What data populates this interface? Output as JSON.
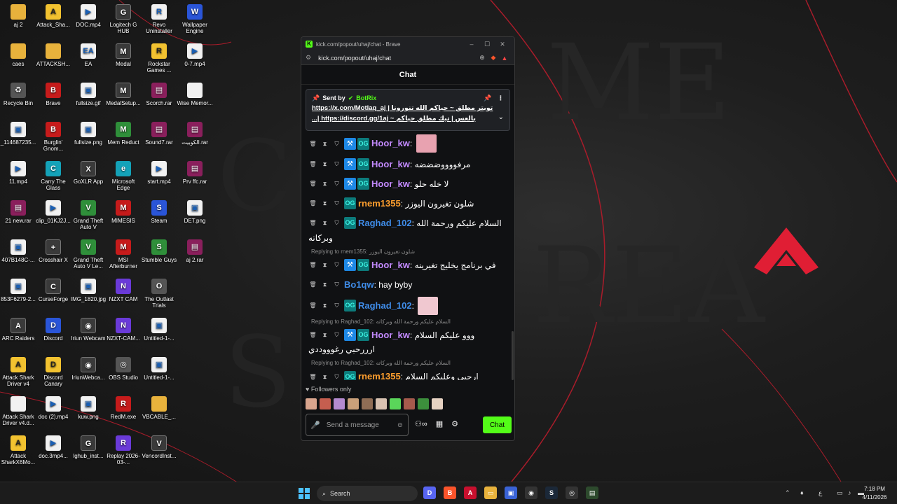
{
  "desktop": {
    "icons": [
      {
        "label": "aj 2",
        "glyph": "",
        "kind": "folder",
        "col": 0,
        "row": 0
      },
      {
        "label": "Attack_Sha...",
        "glyph": "A",
        "kind": "yellow",
        "col": 1,
        "row": 0
      },
      {
        "label": "DOC.mp4",
        "glyph": "▶",
        "kind": "file",
        "col": 2,
        "row": 0
      },
      {
        "label": "Logitech G HUB",
        "glyph": "G",
        "kind": "app",
        "col": 3,
        "row": 0
      },
      {
        "label": "Revo Uninstaller",
        "glyph": "R",
        "kind": "file",
        "col": 4,
        "row": 0
      },
      {
        "label": "Wallpaper Engine",
        "glyph": "W",
        "kind": "blue",
        "col": 5,
        "row": 0
      },
      {
        "label": "caes",
        "glyph": "",
        "kind": "folder",
        "col": 0,
        "row": 1
      },
      {
        "label": "ATTACKSH...",
        "glyph": "",
        "kind": "folder",
        "col": 1,
        "row": 1
      },
      {
        "label": "EA",
        "glyph": "EA",
        "kind": "file",
        "col": 2,
        "row": 1
      },
      {
        "label": "Medal",
        "glyph": "M",
        "kind": "app",
        "col": 3,
        "row": 1
      },
      {
        "label": "Rockstar Games ...",
        "glyph": "R",
        "kind": "yellow",
        "col": 4,
        "row": 1
      },
      {
        "label": "0-7.mp4",
        "glyph": "▶",
        "kind": "file",
        "col": 5,
        "row": 1
      },
      {
        "label": "Recycle Bin",
        "glyph": "♻",
        "kind": "gray",
        "col": 0,
        "row": 2
      },
      {
        "label": "Brave",
        "glyph": "B",
        "kind": "red",
        "col": 1,
        "row": 2
      },
      {
        "label": "fullsize.gif",
        "glyph": "▣",
        "kind": "file",
        "col": 2,
        "row": 2
      },
      {
        "label": "MedalSetup...",
        "glyph": "M",
        "kind": "app",
        "col": 3,
        "row": 2
      },
      {
        "label": "Scorch.rar",
        "glyph": "▤",
        "kind": "rar",
        "col": 4,
        "row": 2
      },
      {
        "label": "Wise Memor...",
        "glyph": "",
        "kind": "file",
        "col": 5,
        "row": 2
      },
      {
        "label": "_114687235...",
        "glyph": "▣",
        "kind": "file",
        "col": 0,
        "row": 3
      },
      {
        "label": "Burglin' Gnom...",
        "glyph": "B",
        "kind": "red",
        "col": 1,
        "row": 3
      },
      {
        "label": "fullsize.png",
        "glyph": "▣",
        "kind": "file",
        "col": 2,
        "row": 3
      },
      {
        "label": "Mem Reduct",
        "glyph": "M",
        "kind": "green",
        "col": 3,
        "row": 3
      },
      {
        "label": "Sound7.rar",
        "glyph": "▤",
        "kind": "rar",
        "col": 4,
        "row": 3
      },
      {
        "label": "الكوبيت.rar",
        "glyph": "▤",
        "kind": "rar",
        "col": 5,
        "row": 3
      },
      {
        "label": "11.mp4",
        "glyph": "▶",
        "kind": "file",
        "col": 0,
        "row": 4
      },
      {
        "label": "Carry The Glass",
        "glyph": "C",
        "kind": "teal",
        "col": 1,
        "row": 4
      },
      {
        "label": "GoXLR App",
        "glyph": "X",
        "kind": "app",
        "col": 2,
        "row": 4
      },
      {
        "label": "Microsoft Edge",
        "glyph": "e",
        "kind": "teal",
        "col": 3,
        "row": 4
      },
      {
        "label": "start.mp4",
        "glyph": "▶",
        "kind": "file",
        "col": 4,
        "row": 4
      },
      {
        "label": "Prv ffc.rar",
        "glyph": "▤",
        "kind": "rar",
        "col": 5,
        "row": 4
      },
      {
        "label": "21 new.rar",
        "glyph": "▤",
        "kind": "rar",
        "col": 0,
        "row": 5
      },
      {
        "label": "clip_01KJ2J...",
        "glyph": "▶",
        "kind": "file",
        "col": 1,
        "row": 5
      },
      {
        "label": "Grand Theft Auto V",
        "glyph": "V",
        "kind": "green",
        "col": 2,
        "row": 5
      },
      {
        "label": "MIMESIS",
        "glyph": "M",
        "kind": "red",
        "col": 3,
        "row": 5
      },
      {
        "label": "Steam",
        "glyph": "S",
        "kind": "blue",
        "col": 4,
        "row": 5
      },
      {
        "label": "DET.png",
        "glyph": "▣",
        "kind": "file",
        "col": 5,
        "row": 5
      },
      {
        "label": "407B148C-...",
        "glyph": "▣",
        "kind": "file",
        "col": 0,
        "row": 6
      },
      {
        "label": "Crosshair X",
        "glyph": "+",
        "kind": "app",
        "col": 1,
        "row": 6
      },
      {
        "label": "Grand Theft Auto V Le...",
        "glyph": "V",
        "kind": "green",
        "col": 2,
        "row": 6
      },
      {
        "label": "MSI Afterburner",
        "glyph": "M",
        "kind": "red",
        "col": 3,
        "row": 6
      },
      {
        "label": "Stumble Guys",
        "glyph": "S",
        "kind": "green",
        "col": 4,
        "row": 6
      },
      {
        "label": "aj 2.rar",
        "glyph": "▤",
        "kind": "rar",
        "col": 5,
        "row": 6
      },
      {
        "label": "853F6279-2...",
        "glyph": "▣",
        "kind": "file",
        "col": 0,
        "row": 7
      },
      {
        "label": "CurseForge",
        "glyph": "C",
        "kind": "app",
        "col": 1,
        "row": 7
      },
      {
        "label": "IMG_1820.jpg",
        "glyph": "▣",
        "kind": "file",
        "col": 2,
        "row": 7
      },
      {
        "label": "NZXT CAM",
        "glyph": "N",
        "kind": "purple",
        "col": 3,
        "row": 7
      },
      {
        "label": "The Outlast Trials",
        "glyph": "O",
        "kind": "gray",
        "col": 4,
        "row": 7
      },
      {
        "label": "ARC Raiders",
        "glyph": "A",
        "kind": "app",
        "col": 0,
        "row": 8
      },
      {
        "label": "Discord",
        "glyph": "D",
        "kind": "blue",
        "col": 1,
        "row": 8
      },
      {
        "label": "Iriun Webcam",
        "glyph": "◉",
        "kind": "app",
        "col": 2,
        "row": 8
      },
      {
        "label": "NZXT-CAM...",
        "glyph": "N",
        "kind": "purple",
        "col": 3,
        "row": 8
      },
      {
        "label": "Untitled-1-...",
        "glyph": "▣",
        "kind": "file",
        "col": 4,
        "row": 8
      },
      {
        "label": "Attack Shark Driver v4",
        "glyph": "A",
        "kind": "yellow",
        "col": 0,
        "row": 9
      },
      {
        "label": "Discord Canary",
        "glyph": "D",
        "kind": "yellow",
        "col": 1,
        "row": 9
      },
      {
        "label": "IriunWebca...",
        "glyph": "◉",
        "kind": "app",
        "col": 2,
        "row": 9
      },
      {
        "label": "OBS Studio",
        "glyph": "◎",
        "kind": "gray",
        "col": 3,
        "row": 9
      },
      {
        "label": "Untitled-1-...",
        "glyph": "▣",
        "kind": "file",
        "col": 4,
        "row": 9
      },
      {
        "label": "Attack Shark Driver v4.d...",
        "glyph": "",
        "kind": "file",
        "col": 0,
        "row": 10
      },
      {
        "label": "doc (2).mp4",
        "glyph": "▶",
        "kind": "file",
        "col": 1,
        "row": 10
      },
      {
        "label": "kuw.png",
        "glyph": "▣",
        "kind": "file",
        "col": 2,
        "row": 10
      },
      {
        "label": "RedM.exe",
        "glyph": "R",
        "kind": "red",
        "col": 3,
        "row": 10
      },
      {
        "label": "VBCABLE_...",
        "glyph": "",
        "kind": "folder",
        "col": 4,
        "row": 10
      },
      {
        "label": "Attack SharkX6Mo...",
        "glyph": "A",
        "kind": "yellow",
        "col": 0,
        "row": 11
      },
      {
        "label": "doc.3mp4...",
        "glyph": "▶",
        "kind": "file",
        "col": 1,
        "row": 11
      },
      {
        "label": "lghub_inst...",
        "glyph": "G",
        "kind": "app",
        "col": 2,
        "row": 11
      },
      {
        "label": "Replay 2026-03-...",
        "glyph": "R",
        "kind": "purple",
        "col": 3,
        "row": 11
      },
      {
        "label": "VencordInst...",
        "glyph": "V",
        "kind": "app",
        "col": 4,
        "row": 11
      }
    ]
  },
  "browser": {
    "title": "kick.com/popout/uhaj/chat - Brave",
    "url": "kick.com/popout/uhaj/chat",
    "minimize": "–",
    "maximize": "☐",
    "close": "✕"
  },
  "chat": {
    "header": "Chat",
    "pinned": {
      "sent_by_label": "Sent by",
      "sender": "BotRix",
      "line1": "تويتر مطلق ~ حياكم الله تنورونا | https://x.com/Motlaq_aj",
      "line2": "بالعس | تيك مطلق حياكم ~ https://discord.gg/1aj |...",
      "more": "⋮",
      "expand": "⌄"
    },
    "messages": [
      {
        "type": "msg",
        "user": "Hoor_kw",
        "color": "purple",
        "badges": [
          "tool",
          "og"
        ],
        "text": "",
        "emote": "#e8a2b0"
      },
      {
        "type": "msg",
        "user": "Hoor_kw",
        "color": "purple",
        "badges": [
          "tool",
          "og"
        ],
        "text": "مرفووووضضضه"
      },
      {
        "type": "msg",
        "user": "Hoor_kw",
        "color": "purple",
        "badges": [
          "tool",
          "og"
        ],
        "text": "لا خله حلو"
      },
      {
        "type": "msg",
        "user": "rnem1355",
        "color": "orange",
        "badges": [
          "og"
        ],
        "text": "شلون تغيرون اليوزر"
      },
      {
        "type": "msg",
        "user": "Raghad_102",
        "color": "blue",
        "badges": [
          "og"
        ],
        "text": "السلام عليكم ورحمة الله وبركاته"
      },
      {
        "type": "reply",
        "text": "Replying to rnem1355: شلون تغيرون اليوزر"
      },
      {
        "type": "msg",
        "user": "Hoor_kw",
        "color": "purple",
        "badges": [
          "tool",
          "og"
        ],
        "text": "في برنامج يخليج تغيرينه"
      },
      {
        "type": "msg",
        "user": "Bo1qw",
        "color": "blue",
        "badges": [],
        "text": "hay byby"
      },
      {
        "type": "msg",
        "user": "Raghad_102",
        "color": "blue",
        "badges": [
          "og"
        ],
        "text": "",
        "emote": "#f0c8d0"
      },
      {
        "type": "reply",
        "text": "Replying to Raghad_102: السلام عليكم ورحمة الله وبركاته"
      },
      {
        "type": "msg",
        "user": "Hoor_kw",
        "color": "purple",
        "badges": [
          "tool",
          "og"
        ],
        "text": "ووو عليكم السلام ارررحبي رغوووددي"
      },
      {
        "type": "reply",
        "text": "Replying to Raghad_102: السلام عليكم ورحمة الله وبركاته"
      },
      {
        "type": "msg",
        "user": "rnem1355",
        "color": "orange",
        "badges": [
          "og"
        ],
        "text": "ارحبي وعليكم السلام"
      }
    ],
    "followers_only": "Followers only",
    "composer_placeholder": "Send a message",
    "send_label": "Chat"
  },
  "taskbar": {
    "search_placeholder": "Search",
    "time": "7:18 PM",
    "date": "4/11/2026",
    "lang": "ع"
  },
  "colors": {
    "kick_green": "#53fc18",
    "purple_user": "#c38aff",
    "orange_user": "#ff9f2e",
    "blue_user": "#3f8ce8"
  }
}
